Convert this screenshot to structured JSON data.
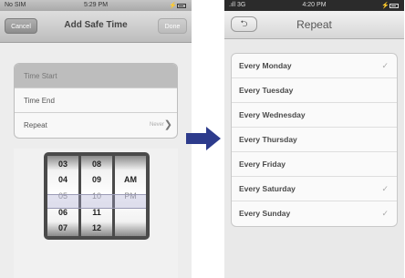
{
  "left": {
    "status": {
      "carrier": "No SIM",
      "time": "5:29 PM"
    },
    "nav": {
      "title": "Add Safe Time",
      "cancel_label": "Cancel",
      "done_label": "Done"
    },
    "rows": [
      {
        "label": "Time Start",
        "detail": "",
        "selected": true
      },
      {
        "label": "Time End",
        "detail": ""
      },
      {
        "label": "Repeat",
        "detail": "Never"
      }
    ],
    "picker": {
      "hours": [
        "03",
        "04",
        "05",
        "06",
        "07"
      ],
      "minutes": [
        "08",
        "09",
        "10",
        "11",
        "12"
      ],
      "ampm": [
        "",
        "AM",
        "PM",
        "",
        ""
      ]
    }
  },
  "right": {
    "status": {
      "carrier": "3G",
      "time": "4:20 PM"
    },
    "nav": {
      "title": "Repeat"
    },
    "days": [
      {
        "label": "Every Monday",
        "checked": true
      },
      {
        "label": "Every Tuesday",
        "checked": false
      },
      {
        "label": "Every Wednesday",
        "checked": false
      },
      {
        "label": "Every Thursday",
        "checked": false
      },
      {
        "label": "Every Friday",
        "checked": false
      },
      {
        "label": "Every Saturday",
        "checked": true
      },
      {
        "label": "Every Sunday",
        "checked": true
      }
    ]
  },
  "colors": {
    "arrow": "#2d3b8c"
  }
}
